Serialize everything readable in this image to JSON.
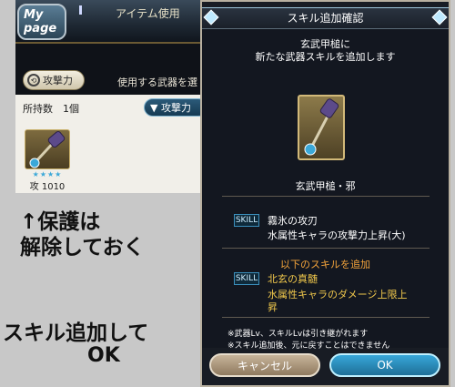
{
  "left_panel": {
    "mypage_label": "My page",
    "top_title": "アイテム使用",
    "attack_chip_label": "攻撃力",
    "weapon_prompt": "使用する武器を選",
    "count_label": "所持数　1個",
    "sort_button_label": "▼ 攻撃力",
    "weapon_card": {
      "stars": "★★★★",
      "atk_label": "攻 1010"
    }
  },
  "dialog": {
    "title": "スキル追加確認",
    "intro_line1": "玄武甲槌に",
    "intro_line2": "新たな武器スキルを追加します",
    "weapon_name": "玄武甲槌・邪",
    "skill_tag": "SKILL",
    "current_skill": {
      "name": "霧氷の攻刃",
      "desc": "水属性キャラの攻撃力上昇(大)"
    },
    "add_heading": "以下のスキルを追加",
    "new_skill": {
      "name": "北玄の真髄",
      "desc_line1": "水属性キャラのダメージ上限上",
      "desc_line2": "昇"
    },
    "note_line1": "※武器Lv、スキルLvは引き継がれます",
    "note_line2": "※スキル追加後、元に戻すことはできません",
    "cancel_label": "キャンセル",
    "ok_label": "OK"
  },
  "annotations": {
    "protect_line1": "↑保護は",
    "protect_line2": "解除しておく",
    "ok_line1": "スキル追加して",
    "ok_line2": "OK"
  },
  "colors": {
    "accent_orange": "#f4a43b",
    "skill_gold": "#f2c94c",
    "ok_blue": "#37a7d9"
  },
  "icons": [
    "swap-icon",
    "weapon-hammer-icon",
    "gem-icon"
  ]
}
